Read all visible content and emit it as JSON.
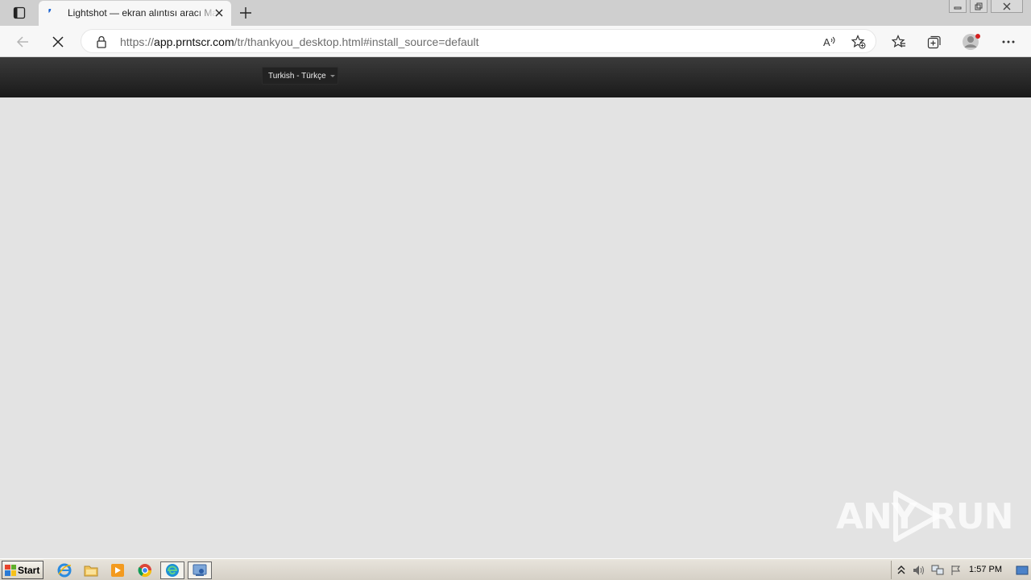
{
  "browser": {
    "tab": {
      "title": "Lightshot — ekran alıntısı aracı Mac & Win"
    },
    "address": {
      "prefix": "https://",
      "host": "app.prntscr.com",
      "path": "/tr/thankyou_desktop.html#install_source=default"
    },
    "read_aloud_label": "A̅)"
  },
  "site": {
    "language_select": {
      "selected": "Turkish - Türkçe"
    }
  },
  "watermark": {
    "left_text": "ANY",
    "right_text": "RUN"
  },
  "taskbar": {
    "start_label": "Start",
    "clock": "1:57 PM"
  },
  "colors": {
    "header_dark": "#1a1a1a",
    "page_bg": "#e3e3e3",
    "favicon_blue": "#1b63d1",
    "profile_badge": "#d42020"
  },
  "icons": {
    "tab_actions": "tab-actions-icon",
    "close_tab": "close-icon",
    "new_tab": "plus-icon",
    "back": "back-arrow-icon",
    "stop": "stop-loading-icon",
    "lock": "lock-icon",
    "read_aloud": "read-aloud-icon",
    "add_favorite": "add-favorite-icon",
    "favorites": "favorites-icon",
    "collections": "collections-icon",
    "profile": "profile-icon",
    "more": "more-icon"
  }
}
